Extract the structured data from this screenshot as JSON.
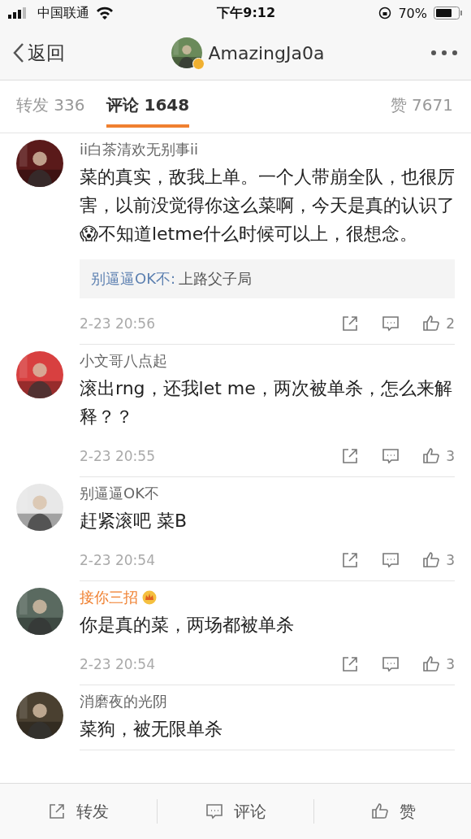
{
  "status_bar": {
    "carrier": "中国联通",
    "time": "下午9:12",
    "battery": "70%"
  },
  "nav": {
    "back": "返回",
    "title": "AmazingJa0a",
    "verified": true
  },
  "tabs": [
    {
      "label": "转发 336",
      "selected": false
    },
    {
      "label": "评论 1648",
      "selected": true
    },
    {
      "label": "赞 7671",
      "selected": false
    }
  ],
  "comments": [
    {
      "user": "ii白茶清欢无别事ii",
      "vip": false,
      "text": "菜的真实，敌我上单。一个人带崩全队，也很厉害，以前没觉得你这么菜啊，今天是真的认识了😱不知道letme什么时候可以上，很想念。",
      "reply": {
        "user": "别逼逼OK不:",
        "text": "上路父子局"
      },
      "time": "2-23 20:56",
      "likes": "2"
    },
    {
      "user": "小文哥八点起",
      "vip": false,
      "text": "滚出rng，还我let me，两次被单杀，怎么来解释？？",
      "time": "2-23 20:55",
      "likes": "3"
    },
    {
      "user": "别逼逼OK不",
      "vip": false,
      "text": "赶紧滚吧 菜B",
      "time": "2-23 20:54",
      "likes": "3"
    },
    {
      "user": "接你三招",
      "vip": true,
      "text": "你是真的菜，两场都被单杀",
      "time": "2-23 20:54",
      "likes": "3"
    },
    {
      "user": "消磨夜的光阴",
      "vip": false,
      "text": "菜狗，被无限单杀"
    }
  ],
  "bottom_bar": [
    {
      "kind": "share",
      "label": "转发"
    },
    {
      "kind": "comment",
      "label": "评论"
    },
    {
      "kind": "like",
      "label": "赞"
    }
  ]
}
